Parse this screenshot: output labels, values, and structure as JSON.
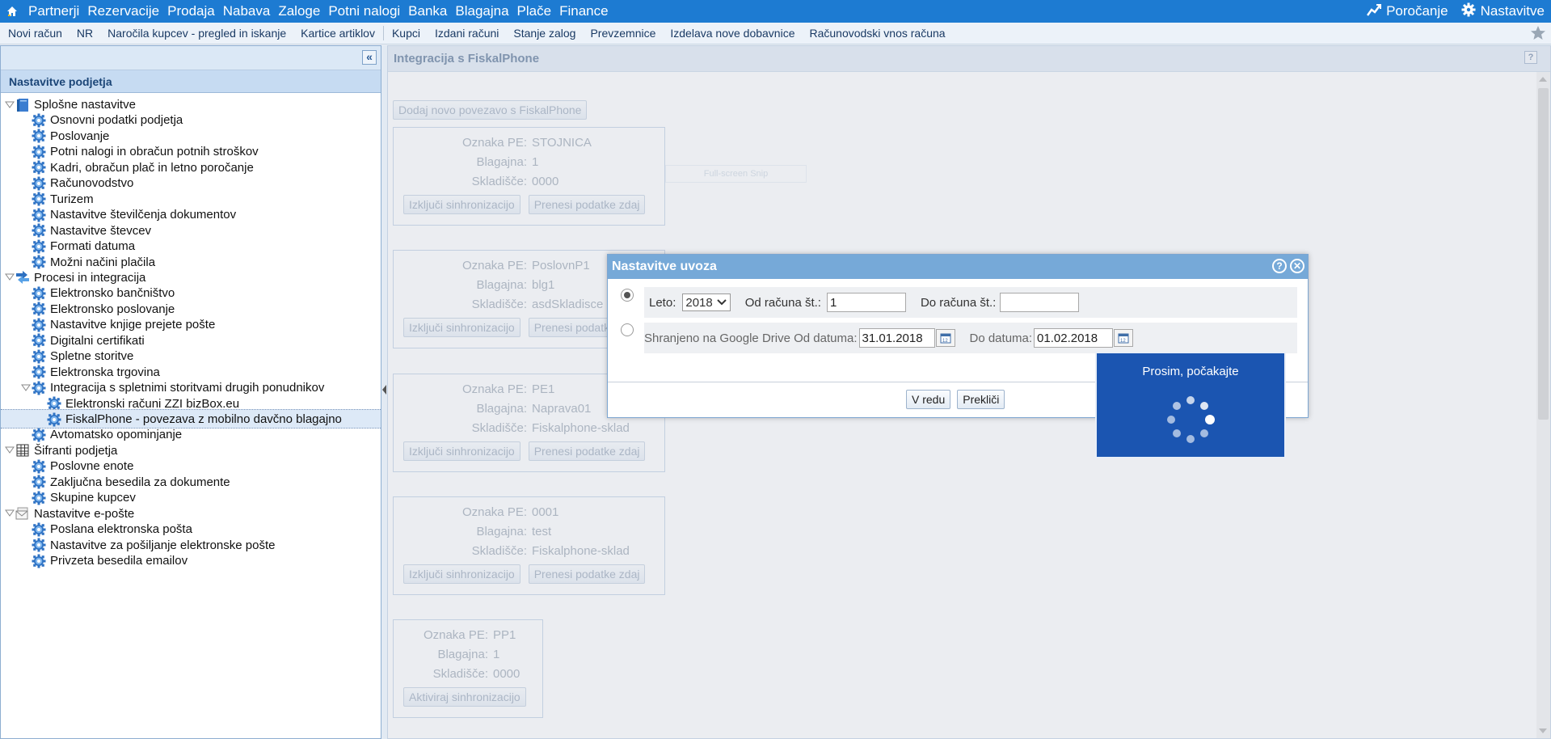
{
  "topnav": {
    "items": [
      "Partnerji",
      "Rezervacije",
      "Prodaja",
      "Nabava",
      "Zaloge",
      "Potni nalogi",
      "Banka",
      "Blagajna",
      "Plače",
      "Finance"
    ],
    "reporting": "Poročanje",
    "settings": "Nastavitve"
  },
  "toolbar": {
    "items": [
      "Novi račun",
      "NR",
      "Naročila kupcev - pregled in iskanje",
      "Kartice artiklov",
      "Kupci",
      "Izdani računi",
      "Stanje zalog",
      "Prevzemnice",
      "Izdelava nove dobavnice",
      "Računovodski vnos računa"
    ]
  },
  "leftpanel": {
    "collapse": "«",
    "title": "Nastavitve podjetja",
    "tree": [
      {
        "label": "Splošne nastavitve",
        "level": 0,
        "icon": "book-icon",
        "expanded": true
      },
      {
        "label": "Osnovni podatki podjetja",
        "level": 1,
        "icon": "gear-icon"
      },
      {
        "label": "Poslovanje",
        "level": 1,
        "icon": "gear-icon"
      },
      {
        "label": "Potni nalogi in obračun potnih stroškov",
        "level": 1,
        "icon": "gear-icon"
      },
      {
        "label": "Kadri, obračun plač in letno poročanje",
        "level": 1,
        "icon": "gear-icon"
      },
      {
        "label": "Računovodstvo",
        "level": 1,
        "icon": "gear-icon"
      },
      {
        "label": "Turizem",
        "level": 1,
        "icon": "gear-icon"
      },
      {
        "label": "Nastavitve številčenja dokumentov",
        "level": 1,
        "icon": "gear-icon"
      },
      {
        "label": "Nastavitve števcev",
        "level": 1,
        "icon": "gear-icon"
      },
      {
        "label": "Formati datuma",
        "level": 1,
        "icon": "gear-icon"
      },
      {
        "label": "Možni načini plačila",
        "level": 1,
        "icon": "gear-icon"
      },
      {
        "label": "Procesi in integracija",
        "level": 0,
        "icon": "process-icon",
        "expanded": true
      },
      {
        "label": "Elektronsko bančništvo",
        "level": 1,
        "icon": "gear-icon"
      },
      {
        "label": "Elektronsko poslovanje",
        "level": 1,
        "icon": "gear-icon"
      },
      {
        "label": "Nastavitve knjige prejete pošte",
        "level": 1,
        "icon": "gear-icon"
      },
      {
        "label": "Digitalni certifikati",
        "level": 1,
        "icon": "gear-icon"
      },
      {
        "label": "Spletne storitve",
        "level": 1,
        "icon": "gear-icon"
      },
      {
        "label": "Elektronska trgovina",
        "level": 1,
        "icon": "gear-icon"
      },
      {
        "label": "Integracija s spletnimi storitvami drugih ponudnikov",
        "level": 1,
        "icon": "gear-icon",
        "expanded": true
      },
      {
        "label": "Elektronski računi ZZI bizBox.eu",
        "level": 2,
        "icon": "gear-icon"
      },
      {
        "label": "FiskalPhone - povezava z mobilno davčno blagajno",
        "level": 2,
        "icon": "gear-icon",
        "selected": true
      },
      {
        "label": "Avtomatsko opominjanje",
        "level": 1,
        "icon": "gear-icon"
      },
      {
        "label": "Šifranti podjetja",
        "level": 0,
        "icon": "table-icon",
        "expanded": true
      },
      {
        "label": "Poslovne enote",
        "level": 1,
        "icon": "gear-icon"
      },
      {
        "label": "Zaključna besedila za dokumente",
        "level": 1,
        "icon": "gear-icon"
      },
      {
        "label": "Skupine kupcev",
        "level": 1,
        "icon": "gear-icon"
      },
      {
        "label": "Nastavitve e-pošte",
        "level": 0,
        "icon": "mail-icon",
        "expanded": true
      },
      {
        "label": "Poslana elektronska pošta",
        "level": 1,
        "icon": "gear-icon"
      },
      {
        "label": "Nastavitve za pošiljanje elektronske pošte",
        "level": 1,
        "icon": "gear-icon"
      },
      {
        "label": "Privzeta besedila emailov",
        "level": 1,
        "icon": "gear-icon"
      }
    ]
  },
  "rightpanel": {
    "title": "Integracija s FiskalPhone",
    "help": "?",
    "add_button": "Dodaj novo povezavo s FiskalPhone",
    "snip_label": "Full-screen Snip",
    "labels": {
      "oznaka": "Oznaka PE:",
      "blagajna": "Blagajna:",
      "skladisce": "Skladišče:"
    },
    "cards": [
      {
        "oznaka": "STOJNICA",
        "blagajna": "1",
        "skladisce": "0000",
        "btn1": "Izključi sinhronizacijo",
        "btn2": "Prenesi podatke zdaj"
      },
      {
        "oznaka": "PoslovnP1",
        "blagajna": "blg1",
        "skladisce": "asdSkladisce",
        "btn1": "Izključi sinhronizacijo",
        "btn2": "Prenesi podatke zdaj"
      },
      {
        "oznaka": "PE1",
        "blagajna": "Naprava01",
        "skladisce": "Fiskalphone-sklad",
        "btn1": "Izključi sinhronizacijo",
        "btn2": "Prenesi podatke zdaj"
      },
      {
        "oznaka": "0001",
        "blagajna": "test",
        "skladisce": "Fiskalphone-sklad",
        "btn1": "Izključi sinhronizacijo",
        "btn2": "Prenesi podatke zdaj"
      },
      {
        "oznaka": "PP1",
        "blagajna": "1",
        "skladisce": "0000",
        "btn1": "Aktiviraj sinhronizacijo"
      }
    ]
  },
  "dialog": {
    "title": "Nastavitve uvoza",
    "help": "?",
    "close": "✕",
    "row1": {
      "leto_label": "Leto:",
      "leto_value": "2018",
      "od_label": "Od računa št.:",
      "od_value": "1",
      "do_label": "Do računa št.:",
      "do_value": ""
    },
    "row2": {
      "label": "Shranjeno na Google Drive Od datuma:",
      "od_value": "31.01.2018",
      "do_label": "Do datuma:",
      "do_value": "01.02.2018"
    },
    "ok": "V redu",
    "cancel": "Prekliči"
  },
  "wait": {
    "text": "Prosim, počakajte"
  },
  "colors": {
    "topnav": "#1d7bd2",
    "dialog_header": "#76a9d8",
    "wait_box": "#1b55b1"
  }
}
